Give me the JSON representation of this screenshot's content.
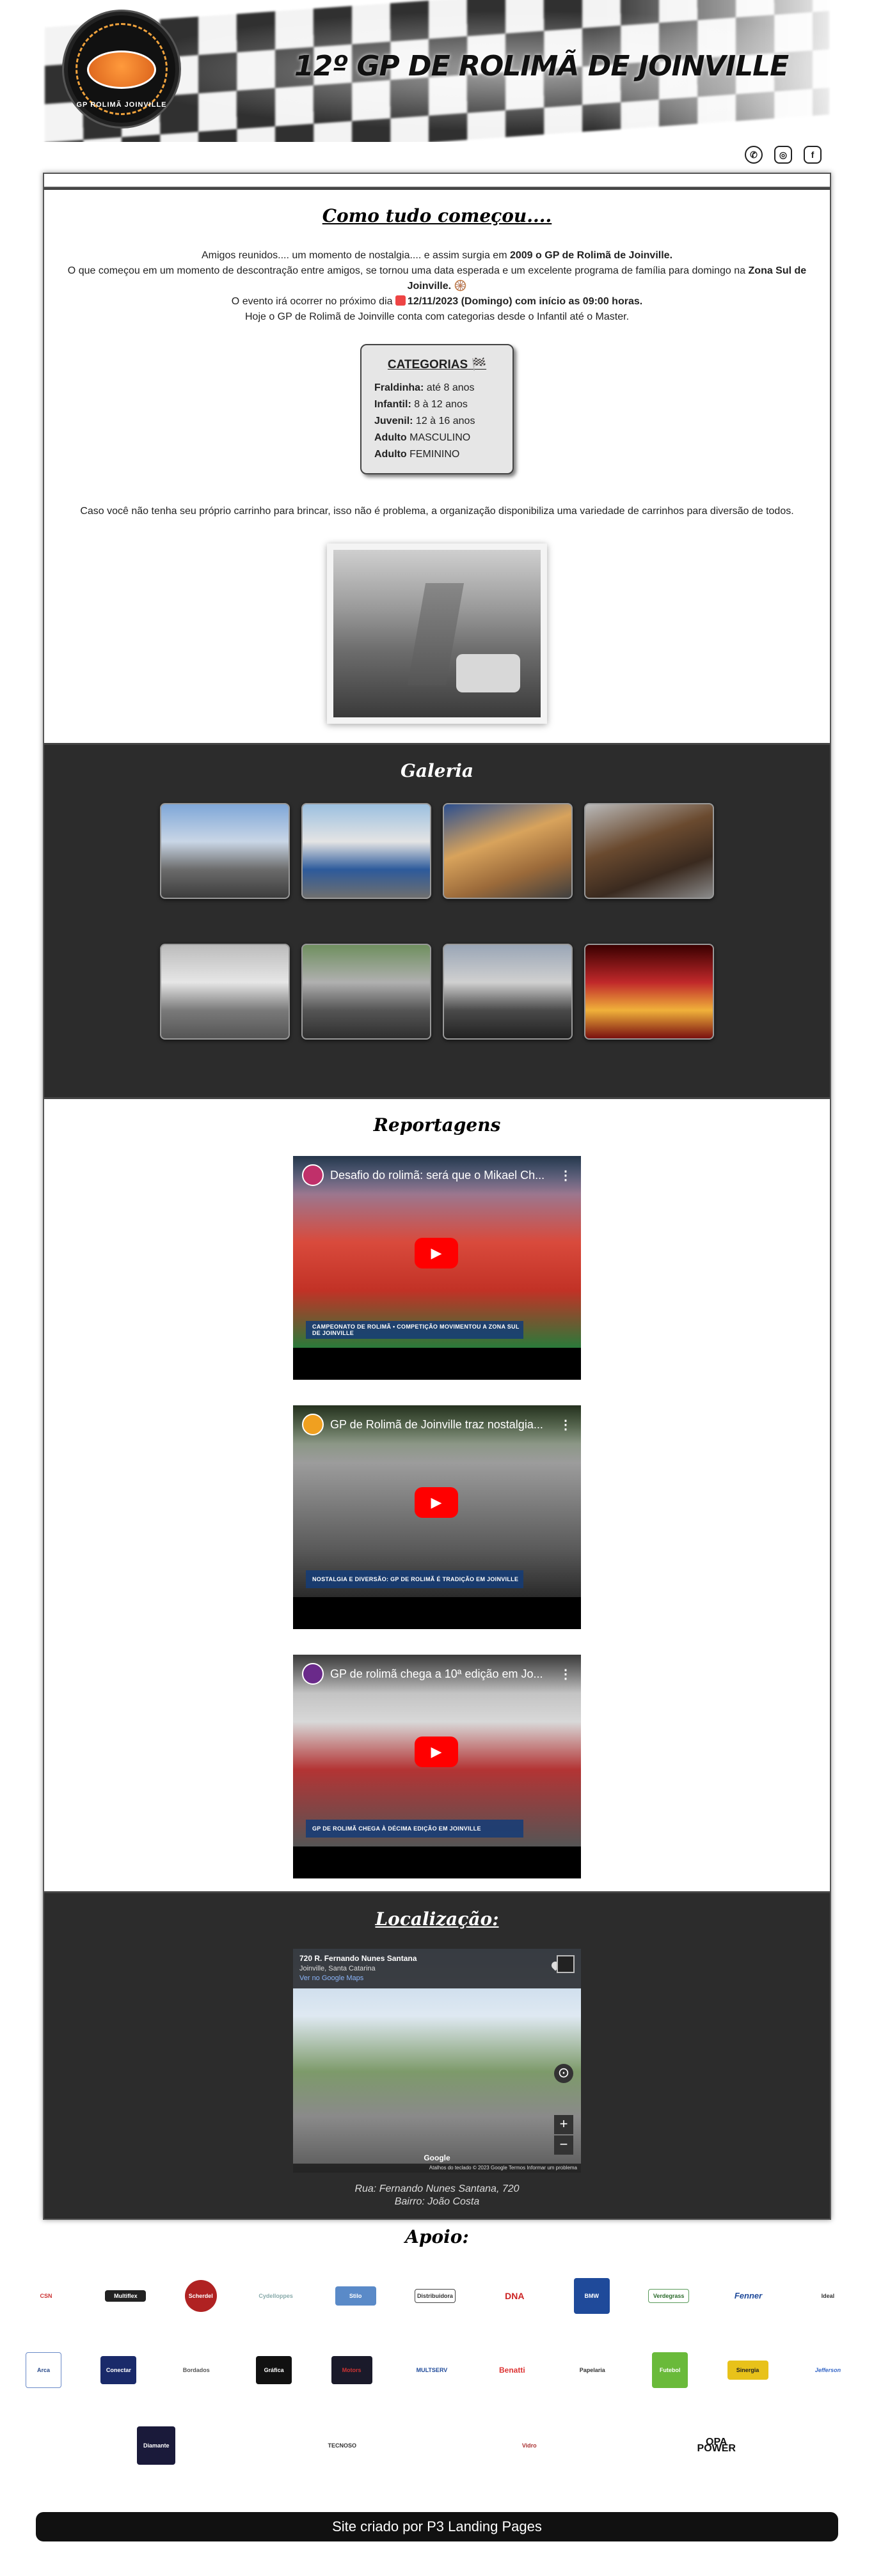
{
  "header": {
    "title": "12º GP DE ROLIMÃ DE JOINVILLE",
    "logo_text": "GP ROLIMÃ JOINVILLE"
  },
  "social": [
    {
      "name": "whatsapp",
      "glyph": "✆"
    },
    {
      "name": "instagram",
      "glyph": "◎"
    },
    {
      "name": "facebook",
      "glyph": "f"
    }
  ],
  "about": {
    "title": "Como tudo começou....",
    "line1_pre": "Amigos reunidos.... um momento de nostalgia.... e assim surgia em ",
    "line1_bold": "2009 o GP de Rolimã de Joinville.",
    "line2_pre": "O que começou em um momento de descontração entre amigos, se tornou uma data esperada e um excelente programa de família para domingo na ",
    "line2_bold": "Zona Sul de Joinville.",
    "line3_pre": "O evento irá ocorrer no próximo dia ",
    "line3_bold": "12/11/2023 (Domingo) com início as 09:00 horas.",
    "line4": "Hoje o GP de Rolimã de Joinville conta com categorias desde o Infantil até o Master.",
    "categories_title": "CATEGORIAS",
    "categories": [
      {
        "name": "Fraldinha:",
        "value": "até 8 anos"
      },
      {
        "name": "Infantil:",
        "value": "8 à 12 anos"
      },
      {
        "name": "Juvenil:",
        "value": "12 à 16 anos"
      },
      {
        "name": "Adulto",
        "value": "MASCULINO"
      },
      {
        "name": "Adulto",
        "value": "FEMININO"
      }
    ],
    "note": "Caso você não tenha seu próprio carrinho para brincar, isso não é problema, a organização disponibiliza uma variedade de carrinhos para diversão de todos."
  },
  "gallery": {
    "title": "Galeria"
  },
  "reports": {
    "title": "Reportagens",
    "videos": [
      {
        "title": "Desafio do rolimã: será que o Mikael Ch...",
        "lower_third": "CAMPEONATO DE ROLIMÃ • COMPETIÇÃO MOVIMENTOU A ZONA SUL DE JOINVILLE"
      },
      {
        "title": "GP de Rolimã de Joinville traz nostalgia...",
        "lower_third": "NOSTALGIA E DIVERSÃO: GP DE ROLIMÃ É TRADIÇÃO EM JOINVILLE"
      },
      {
        "title": "GP de rolimã chega a 10ª edição em Jo...",
        "lower_third": "GP DE ROLIMÃ CHEGA À DÉCIMA EDIÇÃO EM JOINVILLE"
      }
    ]
  },
  "location": {
    "title": "Localização:",
    "map_address": "720 R. Fernando Nunes Santana",
    "map_city": "Joinville, Santa Catarina",
    "map_link": "Ver no Google Maps",
    "google": "Google",
    "map_footer": "Atalhos do teclado  © 2023 Google  Termos  Informar um problema",
    "address_line1": "Rua: Fernando Nunes Santana, 720",
    "address_line2": "Bairro: João Costa"
  },
  "sponsors": {
    "title": "Apoio:",
    "row1": [
      "CSN",
      "Multiflex",
      "Scherdel",
      "Cydelloppes",
      "Stilo",
      "Distribuidora",
      "DNA",
      "BMW",
      "Verdegrass",
      "Fenner",
      "Ideal"
    ],
    "row2": [
      "Arca",
      "Conectar",
      "Bordados",
      "Gráfica",
      "Motors",
      "MULTSERV",
      "Benatti",
      "Papelaria",
      "Futebol",
      "Sinergia",
      "Jefferson"
    ],
    "row3": [
      "Diamante",
      "TECNOSO",
      "Vidro",
      "OPA POWER"
    ]
  },
  "footer": {
    "text": "Site criado por P3 Landing Pages"
  }
}
